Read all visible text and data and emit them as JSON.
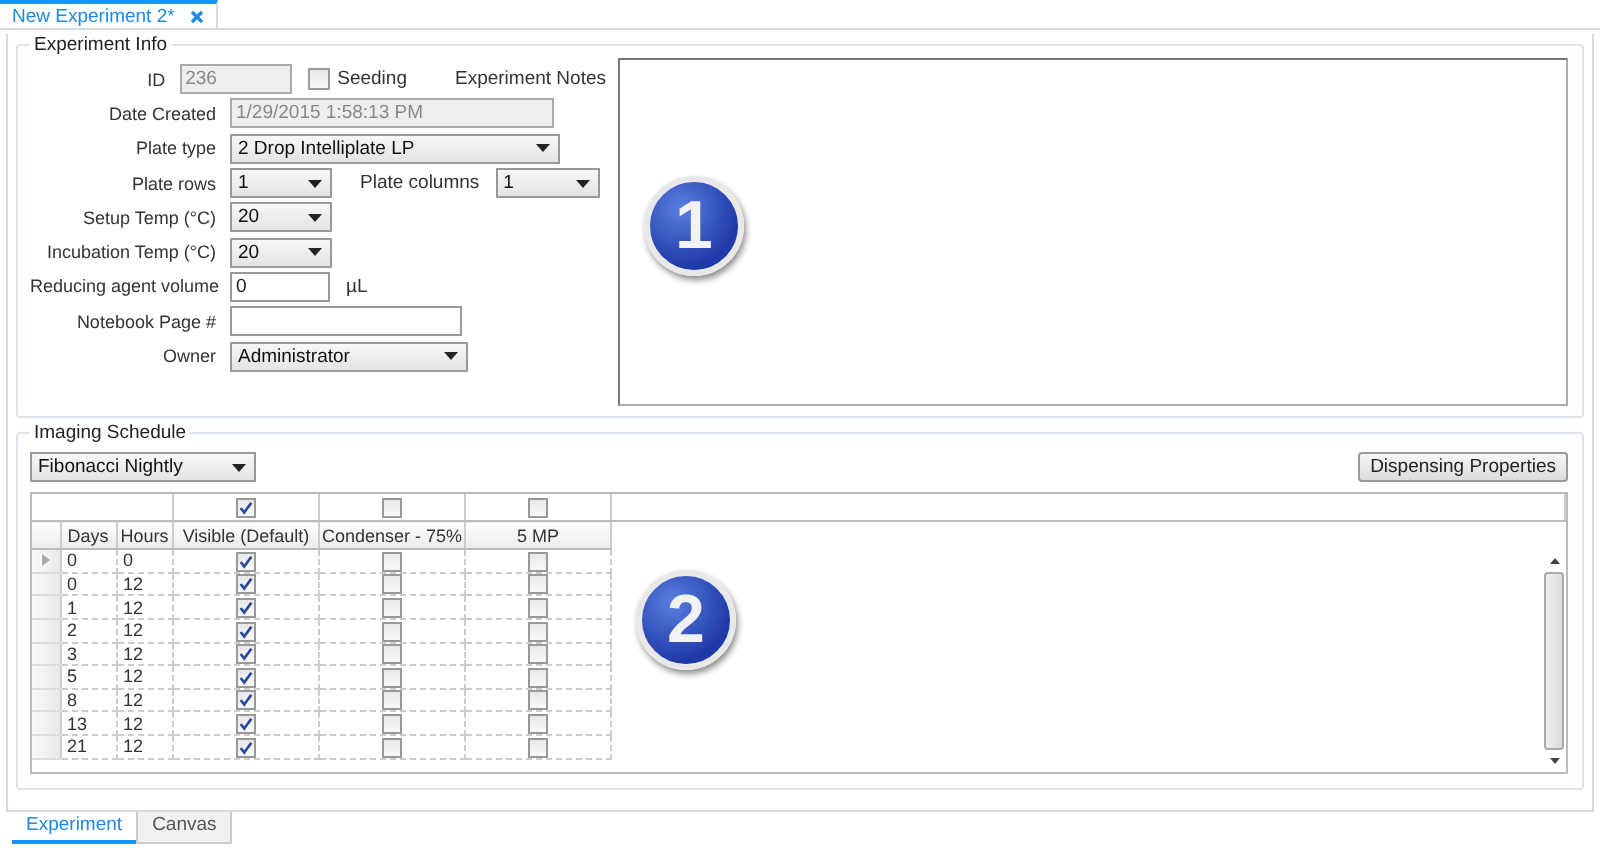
{
  "document_tab": {
    "title": "New Experiment 2*"
  },
  "experiment_info": {
    "title": "Experiment Info",
    "rows": [
      {
        "label": "ID",
        "controls": [
          {
            "kind": "text",
            "value": "236",
            "disabled": true
          },
          {
            "kind": "checkbox",
            "label": "Seeding",
            "checked": false
          },
          {
            "kind": "label",
            "text": "Experiment Notes"
          }
        ]
      },
      {
        "label": "Date Created",
        "controls": [
          {
            "kind": "text",
            "value": "1/29/2015 1:58:13 PM",
            "disabled": true
          }
        ]
      },
      {
        "label": "Plate type",
        "controls": [
          {
            "kind": "select",
            "value": "2 Drop Intelliplate LP"
          }
        ]
      },
      {
        "label": "Plate rows",
        "controls": [
          {
            "kind": "select",
            "value": "1"
          },
          {
            "kind": "label",
            "text": "Plate columns"
          },
          {
            "kind": "select",
            "value": "1"
          }
        ]
      },
      {
        "label": "Setup Temp (°C)",
        "controls": [
          {
            "kind": "select",
            "value": "20"
          }
        ]
      },
      {
        "label": "Incubation Temp (°C)",
        "controls": [
          {
            "kind": "select",
            "value": "20"
          }
        ]
      },
      {
        "label": "Reducing agent volume",
        "controls": [
          {
            "kind": "text",
            "value": "0",
            "disabled": false
          },
          {
            "kind": "label",
            "text": "µL"
          }
        ]
      },
      {
        "label": "Notebook Page #",
        "controls": [
          {
            "kind": "text",
            "disabled": false
          }
        ]
      },
      {
        "label": "Owner",
        "controls": [
          {
            "kind": "select",
            "value": "Administrator"
          }
        ]
      }
    ],
    "notes": {
      "callout": "1"
    }
  },
  "imaging_schedule": {
    "title": "Imaging Schedule",
    "schedule": "Fibonacci Nightly",
    "button": "Dispensing Properties",
    "columns": [
      "Days",
      "Hours"
    ],
    "channels": [
      {
        "name": "Visible (Default)",
        "checked": true
      },
      {
        "name": "Condenser - 75%",
        "checked": false
      },
      {
        "name": "5 MP",
        "checked": false
      }
    ],
    "rows": [
      {
        "days": "0",
        "hours": "0",
        "current": true,
        "checks": [
          true,
          false,
          false
        ]
      },
      {
        "days": "0",
        "hours": "12",
        "current": false,
        "checks": [
          true,
          false,
          false
        ]
      },
      {
        "days": "1",
        "hours": "12",
        "current": false,
        "checks": [
          true,
          false,
          false
        ]
      },
      {
        "days": "2",
        "hours": "12",
        "current": false,
        "checks": [
          true,
          false,
          false
        ]
      },
      {
        "days": "3",
        "hours": "12",
        "current": false,
        "checks": [
          true,
          false,
          false
        ]
      },
      {
        "days": "5",
        "hours": "12",
        "current": false,
        "checks": [
          true,
          false,
          false
        ]
      },
      {
        "days": "8",
        "hours": "12",
        "current": false,
        "checks": [
          true,
          false,
          false
        ]
      },
      {
        "days": "13",
        "hours": "12",
        "current": false,
        "checks": [
          true,
          false,
          false
        ]
      },
      {
        "days": "21",
        "hours": "12",
        "current": false,
        "checks": [
          true,
          false,
          false
        ]
      }
    ],
    "callout": "2"
  },
  "bottom_tabs": [
    {
      "label": "Experiment",
      "selected": true
    },
    {
      "label": "Canvas",
      "selected": false
    }
  ]
}
